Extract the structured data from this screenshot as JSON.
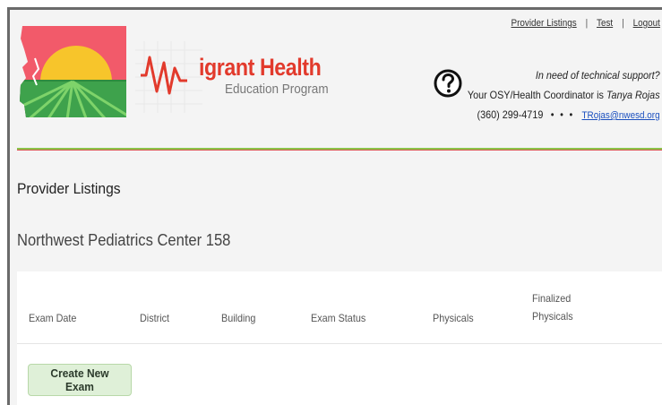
{
  "brand": {
    "name": "Migrant Health",
    "name_rest": "igrant Health",
    "subtitle": "Education Program",
    "colors": {
      "red": "#e23a2c",
      "sun": "#f7c52b",
      "field": "#4caf50",
      "divider_green": "#8bc34a",
      "divider_red": "#d9534f"
    }
  },
  "top_nav": {
    "links": [
      "Provider Listings",
      "Test",
      "Logout"
    ],
    "separator": "|"
  },
  "support": {
    "icon": "question-circle-icon",
    "line1": "In need of technical support?",
    "line2_prefix": "Your OSY/Health Coordinator is",
    "coordinator": "Tanya Rojas",
    "phone": "(360) 299-4719",
    "dots": "• • •",
    "email": "TRojas@nwesd.org"
  },
  "page": {
    "title": "Provider Listings",
    "provider_name": "Northwest Pediatrics Center 158"
  },
  "table": {
    "columns": [
      "Exam Date",
      "District",
      "Building",
      "Exam Status",
      "Physicals",
      "Finalized Physicals"
    ],
    "finalized_line1": "Finalized",
    "finalized_line2": "Physicals"
  },
  "actions": {
    "create_label": "Create New Exam",
    "create_bg": "#dff0d8"
  }
}
